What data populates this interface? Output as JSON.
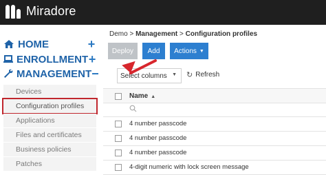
{
  "app": {
    "name": "Miradore"
  },
  "sidebar": {
    "main_items": [
      {
        "label": "HOME",
        "toggle": "+"
      },
      {
        "label": "ENROLLMENT",
        "toggle": "+"
      },
      {
        "label": "MANAGEMENT",
        "toggle": "−"
      }
    ],
    "sub_items": [
      {
        "label": "Devices"
      },
      {
        "label": "Configuration profiles"
      },
      {
        "label": "Applications"
      },
      {
        "label": "Files and certificates"
      },
      {
        "label": "Business policies"
      },
      {
        "label": "Patches"
      }
    ]
  },
  "breadcrumb": {
    "part1": "Demo",
    "sep": ">",
    "part2": "Management",
    "part3": "Configuration profiles"
  },
  "toolbar": {
    "deploy": "Deploy",
    "add": "Add",
    "actions": "Actions"
  },
  "filters": {
    "select_columns": "Select columns",
    "refresh": "Refresh"
  },
  "table": {
    "header": "Name",
    "rows": [
      {
        "name": "4 number passcode"
      },
      {
        "name": "4 number passcode"
      },
      {
        "name": "4 number passcode"
      },
      {
        "name": "4-digit numeric with lock screen message"
      }
    ]
  },
  "colors": {
    "accent": "#2d7fd0",
    "nav": "#1f63a8",
    "highlight": "#c0262d",
    "topbar": "#1f1f1f"
  }
}
